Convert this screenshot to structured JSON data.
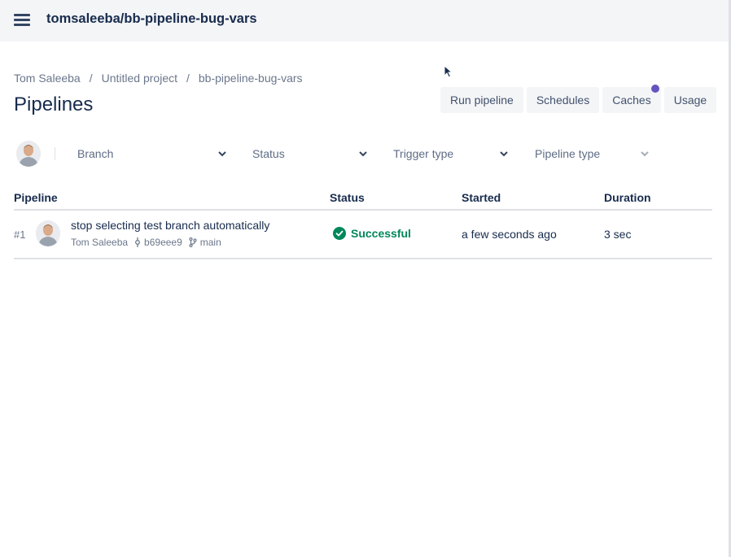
{
  "header": {
    "repo_title": "tomsaleeba/bb-pipeline-bug-vars"
  },
  "breadcrumb": [
    "Tom Saleeba",
    "Untitled project",
    "bb-pipeline-bug-vars"
  ],
  "breadcrumb_separator": "/",
  "page": {
    "title": "Pipelines"
  },
  "actions": {
    "run_pipeline": "Run pipeline",
    "schedules": "Schedules",
    "caches": "Caches",
    "usage": "Usage"
  },
  "filters": {
    "branch": "Branch",
    "status": "Status",
    "trigger_type": "Trigger type",
    "pipeline_type": "Pipeline type"
  },
  "table": {
    "columns": [
      "Pipeline",
      "Status",
      "Started",
      "Duration"
    ],
    "rows": [
      {
        "number": "#1",
        "title": "stop selecting test branch automatically",
        "author": "Tom Saleeba",
        "commit": "b69eee9",
        "branch": "main",
        "status": "Successful",
        "started": "a few seconds ago",
        "duration": "3 sec"
      }
    ]
  },
  "colors": {
    "topbar_bg": "#f4f5f7",
    "text_primary": "#172b4d",
    "text_muted": "#6b778c",
    "success": "#00875a",
    "notification_dot": "#6554c0"
  },
  "icons": [
    "menu-icon",
    "chevron-down-icon",
    "commit-icon",
    "branch-icon",
    "check-circle-icon"
  ]
}
